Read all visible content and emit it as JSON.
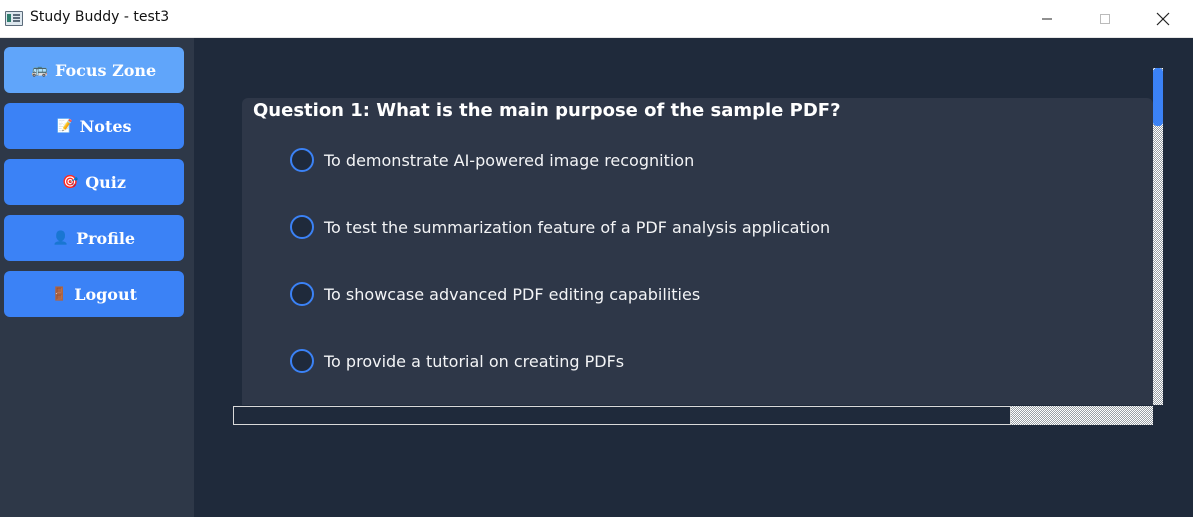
{
  "window": {
    "title": "Study Buddy - test3",
    "icon": "app-icon",
    "controls": [
      "minimize-icon",
      "maximize-icon",
      "close-icon"
    ]
  },
  "sidebar": {
    "items": [
      {
        "icon": "🚌",
        "icon_name": "bus-icon",
        "label": "Focus Zone",
        "active": true
      },
      {
        "icon": "📝",
        "icon_name": "memo-icon",
        "label": "Notes",
        "active": false
      },
      {
        "icon": "🎯",
        "icon_name": "target-icon",
        "label": "Quiz",
        "active": false
      },
      {
        "icon": "👤",
        "icon_name": "user-icon",
        "label": "Profile",
        "active": false
      },
      {
        "icon": "🚪",
        "icon_name": "door-icon",
        "label": "Logout",
        "active": false
      }
    ]
  },
  "quiz": {
    "question": "Question 1: What is the main purpose of the sample PDF?",
    "options": [
      "To demonstrate AI-powered image recognition",
      "To test the summarization feature of a PDF analysis application",
      "To showcase advanced PDF editing capabilities",
      "To provide a tutorial on creating PDFs"
    ]
  },
  "colors": {
    "background": "#1f2a3b",
    "sidebar": "#2e3848",
    "card": "#2e3748",
    "accent": "#3b82f6",
    "accent_active": "#60a5fa"
  }
}
